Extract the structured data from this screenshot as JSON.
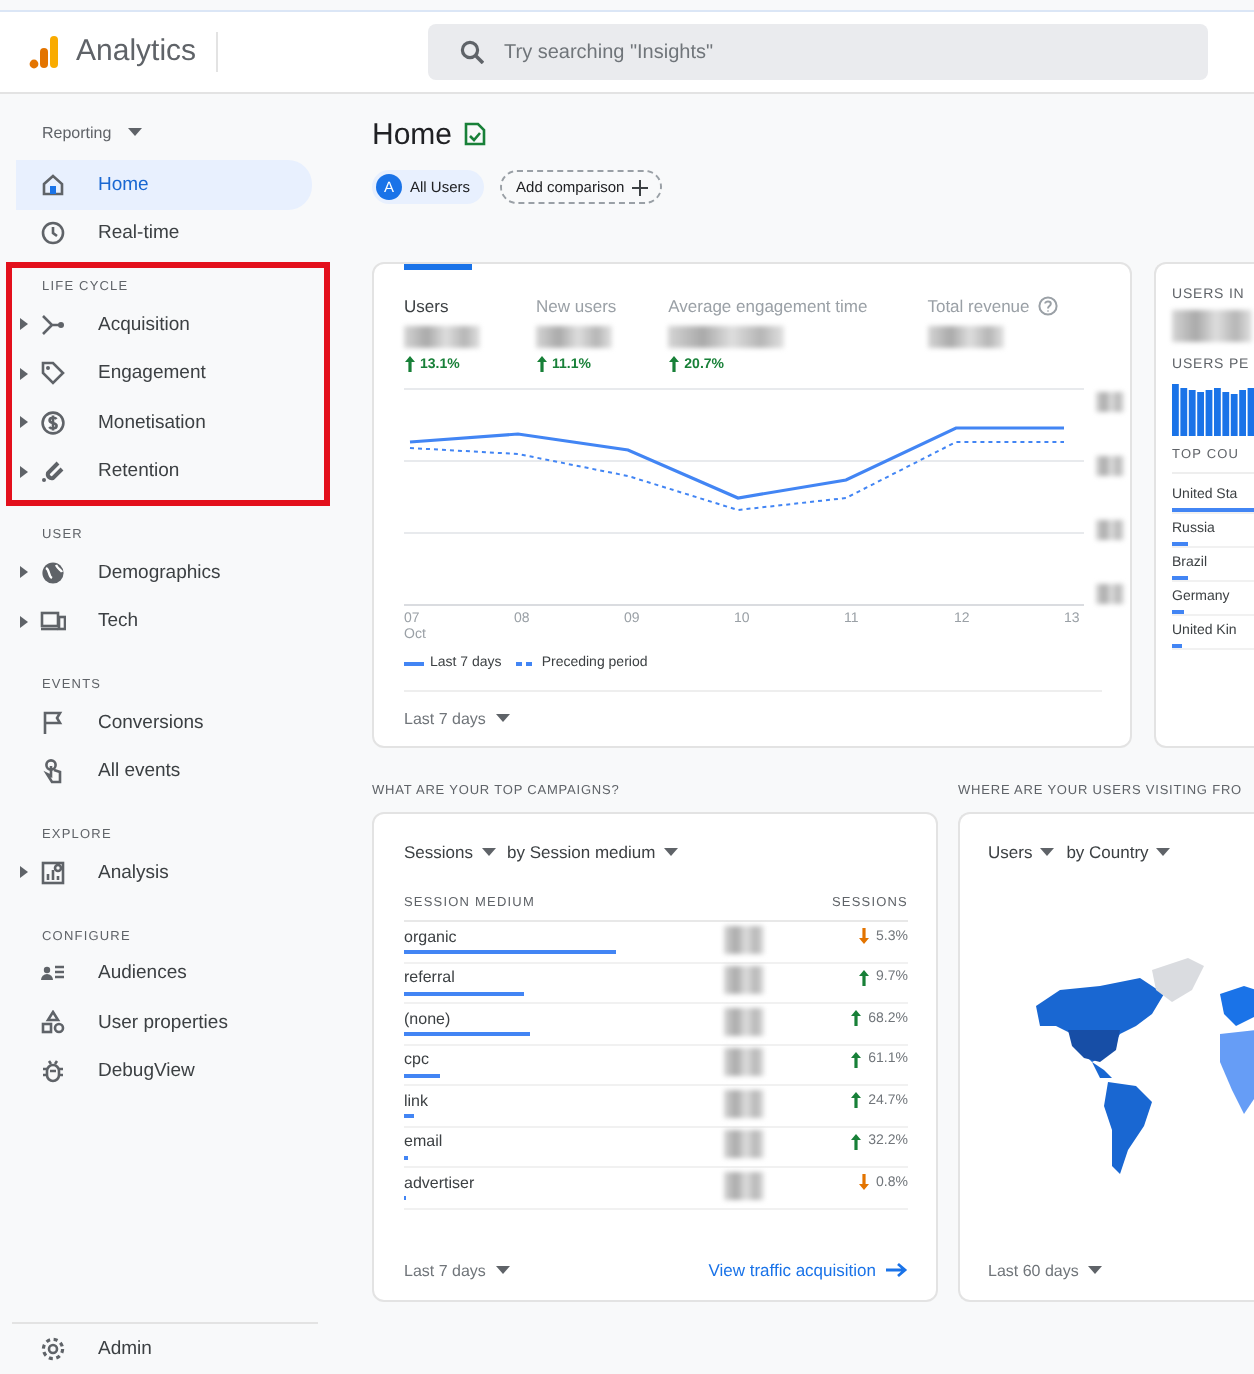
{
  "app": {
    "name": "Analytics"
  },
  "search": {
    "placeholder": "Try searching \"Insights\""
  },
  "sidebar": {
    "dropdown": "Reporting",
    "items": [
      {
        "label": "Home",
        "selected": true
      },
      {
        "label": "Real-time",
        "selected": false
      }
    ],
    "sections": [
      {
        "title": "LIFE CYCLE",
        "highlighted": true,
        "items": [
          {
            "label": "Acquisition",
            "expandable": true
          },
          {
            "label": "Engagement",
            "expandable": true
          },
          {
            "label": "Monetisation",
            "expandable": true
          },
          {
            "label": "Retention",
            "expandable": true
          }
        ]
      },
      {
        "title": "USER",
        "highlighted": false,
        "items": [
          {
            "label": "Demographics",
            "expandable": true
          },
          {
            "label": "Tech",
            "expandable": true
          }
        ]
      },
      {
        "title": "EVENTS",
        "highlighted": false,
        "items": [
          {
            "label": "Conversions",
            "expandable": false
          },
          {
            "label": "All events",
            "expandable": false
          }
        ]
      },
      {
        "title": "EXPLORE",
        "highlighted": false,
        "items": [
          {
            "label": "Analysis",
            "expandable": true
          }
        ]
      },
      {
        "title": "CONFIGURE",
        "highlighted": false,
        "items": [
          {
            "label": "Audiences",
            "expandable": false
          },
          {
            "label": "User properties",
            "expandable": false
          },
          {
            "label": "DebugView",
            "expandable": false
          }
        ]
      }
    ],
    "footer": {
      "label": "Admin"
    }
  },
  "page": {
    "title": "Home",
    "chips": [
      {
        "kind": "segment",
        "badge": "A",
        "label": "All Users"
      },
      {
        "kind": "add",
        "label": "Add comparison"
      }
    ]
  },
  "overview": {
    "metrics": [
      {
        "label": "Users",
        "selected": true,
        "change": "13.1%",
        "kind": "up"
      },
      {
        "label": "New users",
        "selected": false,
        "change": "11.1%",
        "kind": "up"
      },
      {
        "label": "Average engagement time",
        "selected": false,
        "change": "20.7%",
        "kind": "up"
      },
      {
        "label": "Total revenue",
        "selected": false,
        "info": true
      }
    ],
    "x_labels": [
      {
        "day": "07",
        "month": "Oct"
      },
      {
        "day": "08"
      },
      {
        "day": "09"
      },
      {
        "day": "10"
      },
      {
        "day": "11"
      },
      {
        "day": "12"
      },
      {
        "day": "13"
      }
    ],
    "legend": [
      {
        "kind": "solid",
        "label": "Last 7 days"
      },
      {
        "kind": "dashed",
        "label": "Preceding period"
      }
    ],
    "range": "Last 7 days"
  },
  "realtime": {
    "title": "USERS IN",
    "subtitle": "USERS PE",
    "table_heading": "TOP COU",
    "countries": [
      {
        "name": "United Sta",
        "level": 1
      },
      {
        "name": "Russia",
        "level": 0.2
      },
      {
        "name": "Brazil",
        "level": 0.18
      },
      {
        "name": "Germany",
        "level": 0.14
      },
      {
        "name": "United Kin",
        "level": 0.12
      }
    ]
  },
  "campaigns": {
    "heading": "WHAT ARE YOUR TOP CAMPAIGNS?",
    "metric": "Sessions",
    "dimension": "by Session medium",
    "columns": [
      "SESSION MEDIUM",
      "SESSIONS"
    ],
    "rows": [
      {
        "medium": "organic",
        "level": 0.42,
        "change": "5.3%",
        "kind": "down"
      },
      {
        "medium": "referral",
        "level": 0.24,
        "change": "9.7%",
        "kind": "up"
      },
      {
        "medium": "(none)",
        "level": 0.25,
        "change": "68.2%",
        "kind": "up"
      },
      {
        "medium": "cpc",
        "level": 0.07,
        "change": "61.1%",
        "kind": "up"
      },
      {
        "medium": "link",
        "level": 0.02,
        "change": "24.7%",
        "kind": "up"
      },
      {
        "medium": "email",
        "level": 0.008,
        "change": "32.2%",
        "kind": "up"
      },
      {
        "medium": "advertiser",
        "level": 0.005,
        "change": "0.8%",
        "kind": "down"
      }
    ],
    "range": "Last 7 days",
    "link": "View traffic acquisition"
  },
  "geo": {
    "heading": "WHERE ARE YOUR USERS VISITING FRO",
    "metric": "Users",
    "dimension": "by Country",
    "range": "Last 60 days"
  }
}
